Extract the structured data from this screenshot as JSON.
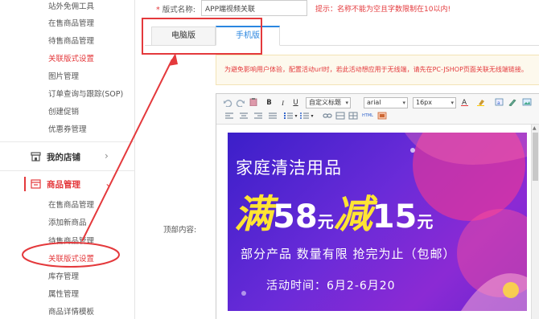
{
  "sidebar": {
    "top_items": [
      {
        "label": "站外免佣工具",
        "red": false
      },
      {
        "label": "在售商品管理",
        "red": false
      },
      {
        "label": "待售商品管理",
        "red": false
      },
      {
        "label": "关联版式设置",
        "red": true
      },
      {
        "label": "图片管理",
        "red": false
      },
      {
        "label": "订单查询与跟踪(SOP)",
        "red": false
      },
      {
        "label": "创建促销",
        "red": false
      },
      {
        "label": "优惠券管理",
        "red": false
      }
    ],
    "group_store": {
      "label": "我的店铺",
      "icon": "store-icon"
    },
    "group_product": {
      "label": "商品管理",
      "icon": "product-icon"
    },
    "product_items": [
      {
        "label": "在售商品管理",
        "red": false
      },
      {
        "label": "添加新商品",
        "red": false
      },
      {
        "label": "待售商品管理",
        "red": false
      },
      {
        "label": "关联版式设置",
        "red": true
      },
      {
        "label": "库存管理",
        "red": false
      },
      {
        "label": "属性管理",
        "red": false
      },
      {
        "label": "商品详情模板",
        "red": false
      }
    ]
  },
  "form": {
    "name_label_star": "*",
    "name_label": "版式名称:",
    "name_value": "APP端视频关联",
    "name_hint": "提示：名称不能为空且字数限制在10以内!",
    "top_content_label": "顶部内容:"
  },
  "tabs": {
    "pc": "电脑版",
    "mobile": "手机版",
    "active": "mobile"
  },
  "notice": "为避免影响用户体验，配置活动url时，若此活动想应用于无线端，请先在PC-JSHOP页面关联无线端链接。",
  "toolbar": {
    "bold": "B",
    "italic": "I",
    "underline": "U",
    "format_select": "自定义标题",
    "font_select": "arial",
    "size_select": "16px",
    "icons": [
      "undo-icon",
      "redo-icon",
      "paste-icon",
      "bold-icon",
      "italic-icon",
      "underline-icon",
      "font-color-icon",
      "highlight-icon",
      "clear-format-icon",
      "align-left-icon",
      "align-center-icon",
      "align-right-icon",
      "justify-icon",
      "ordered-list-icon",
      "unordered-list-icon",
      "link-icon",
      "unlink-icon",
      "table-icon",
      "html-icon",
      "image-icon"
    ]
  },
  "banner": {
    "title": "家庭清洁用品",
    "deal_char1": "满",
    "deal_num1": "58",
    "deal_unit1": "元",
    "deal_char2": "减",
    "deal_num2": "15",
    "deal_unit2": "元",
    "subtitle": "部分产品  数量有限  抢完为止（包邮）",
    "date": "活动时间：6月2-6月20"
  },
  "colors": {
    "accent_red": "#e4393c",
    "tab_blue": "#2a86e0",
    "banner_yellow": "#ffe433",
    "banner_purple": "#5b25d3"
  }
}
